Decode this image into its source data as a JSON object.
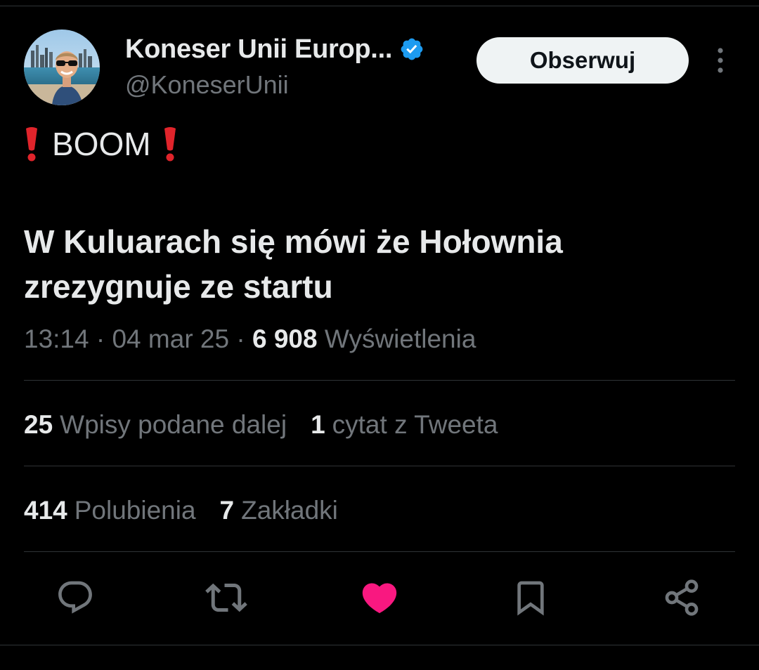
{
  "author": {
    "display_name": "Koneser Unii Europ...",
    "handle": "@KoneserUnii",
    "verified": true
  },
  "follow_label": "Obserwuj",
  "tweet": {
    "headline_text": "BOOM",
    "body_text": "W Kuluarach się mówi że Hołownia zrezygnuje ze startu"
  },
  "meta": {
    "time": "13:14",
    "separator": " · ",
    "date": "04 mar 25",
    "views_count": "6 908",
    "views_label": "Wyświetlenia"
  },
  "stats": {
    "reposts_count": "25",
    "reposts_label": "Wpisy podane dalej",
    "quotes_count": "1",
    "quotes_label": "cytat z Tweeta",
    "likes_count": "414",
    "likes_label": "Polubienia",
    "bookmarks_count": "7",
    "bookmarks_label": "Zakładki"
  },
  "icons": {
    "verified": "verified-badge-icon",
    "more": "more-vertical-icon",
    "exclamation": "red-exclamation-icon",
    "reply": "reply-icon",
    "repost": "repost-icon",
    "like": "heart-icon",
    "bookmark": "bookmark-icon",
    "share": "share-icon"
  },
  "colors": {
    "background": "#000000",
    "text_primary": "#e7e9ea",
    "text_secondary": "#71767b",
    "divider": "#2f3336",
    "verified_blue": "#1d9bf0",
    "like_pink": "#f91880",
    "exclamation_red": "#e0242b"
  },
  "state": {
    "liked": true
  }
}
